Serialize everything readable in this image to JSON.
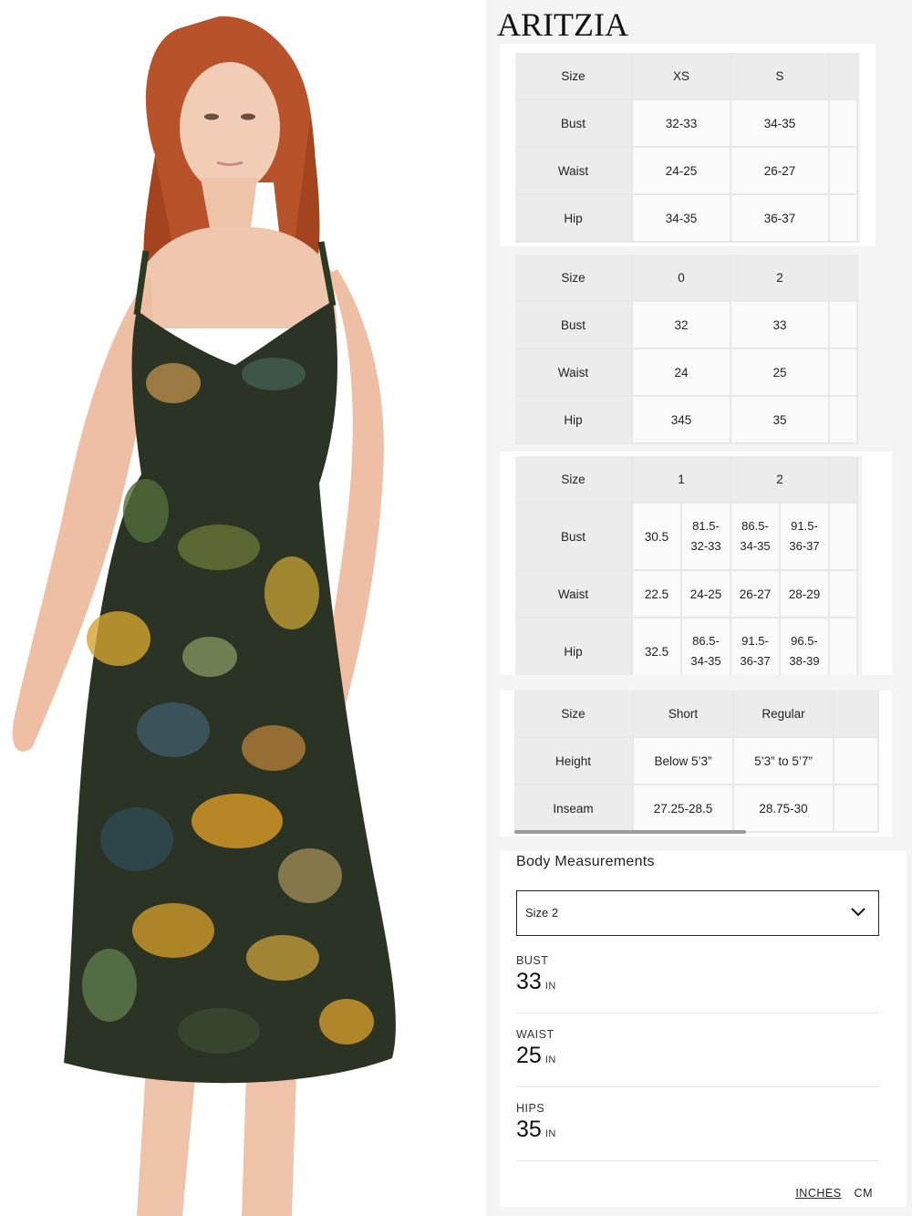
{
  "brand": "ARITZIA",
  "tables": [
    {
      "rows": [
        [
          "Size",
          "XS",
          "S"
        ],
        [
          "Bust",
          "32-33",
          "34-35"
        ],
        [
          "Waist",
          "24-25",
          "26-27"
        ],
        [
          "Hip",
          "34-35",
          "36-37"
        ]
      ]
    },
    {
      "rows": [
        [
          "Size",
          "0",
          "2"
        ],
        [
          "Bust",
          "32",
          "33"
        ],
        [
          "Waist",
          "24",
          "25"
        ],
        [
          "Hip",
          "345",
          "35"
        ]
      ]
    },
    {
      "header": [
        "Size",
        "1",
        "2"
      ],
      "rows": [
        [
          "Bust",
          "30.5",
          "81.5-",
          "32-33",
          "86.5-",
          "34-35",
          "91.5-",
          "36-37"
        ],
        [
          "Waist",
          "22.5",
          "24-25",
          "26-27",
          "28-29"
        ],
        [
          "Hip",
          "32.5",
          "86.5-",
          "34-35",
          "91.5-",
          "36-37",
          "96.5-",
          "38-39"
        ]
      ]
    },
    {
      "rows": [
        [
          "Size",
          "Short",
          "Regular"
        ],
        [
          "Height",
          "Below 5’3”",
          "5’3” to 5’7”"
        ],
        [
          "Inseam",
          "27.25-28.5",
          "28.75-30"
        ]
      ]
    }
  ],
  "body_measurements": {
    "title": "Body Measurements",
    "selected_size": "Size 2",
    "items": [
      {
        "label": "BUST",
        "value": "33",
        "unit": "IN"
      },
      {
        "label": "WAIST",
        "value": "25",
        "unit": "IN"
      },
      {
        "label": "HIPS",
        "value": "35",
        "unit": "IN"
      }
    ],
    "units": {
      "inches": "INCHES",
      "cm": "CM"
    }
  },
  "colors": {
    "accent": "#111111",
    "table_header": "#ececec",
    "table_cell": "#fafafa"
  },
  "icons": {
    "dropdown": "chevron-down-icon"
  }
}
